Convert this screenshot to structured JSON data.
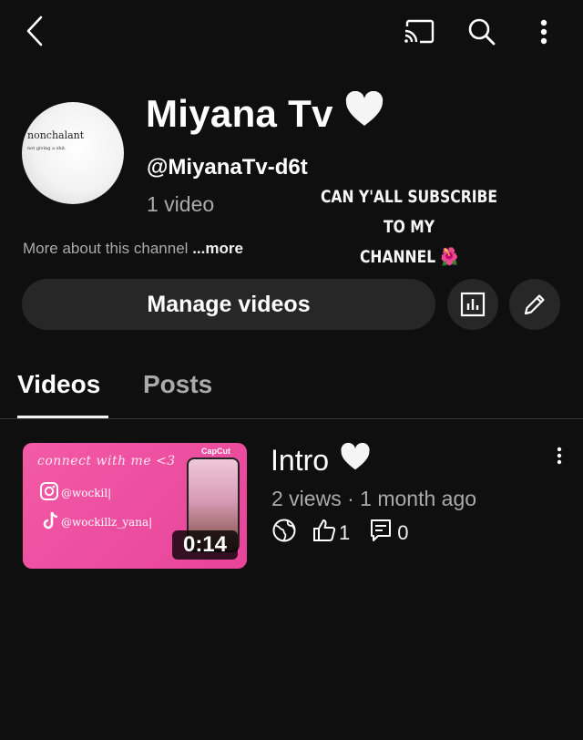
{
  "channel": {
    "name": "Miyana Tv",
    "handle": "@MiyanaTv-d6t",
    "video_count": "1 video",
    "about": "More about this channel",
    "about_more": "...more",
    "avatar_text_main": "nonchalant",
    "avatar_text_sub": "not giving a shit."
  },
  "promo": {
    "line1": "CAN Y'ALL SUBSCRIBE TO MY",
    "line2": "CHANNEL",
    "emoji": "🌺"
  },
  "actions": {
    "manage_label": "Manage videos"
  },
  "tabs": [
    {
      "label": "Videos",
      "active": true
    },
    {
      "label": "Posts",
      "active": false
    }
  ],
  "videos": [
    {
      "title": "Intro",
      "views": "2 views",
      "age": "1 month ago",
      "duration": "0:14",
      "likes": "1",
      "comments": "0",
      "thumbnail": {
        "connect_text": "connect with me <3",
        "instagram": "@wockil|",
        "tiktok": "@wockillz_yana|",
        "brand": "CapCut"
      }
    }
  ],
  "icons": {
    "back": "back-arrow-icon",
    "cast": "cast-icon",
    "search": "search-icon",
    "menu": "more-vert-icon",
    "analytics": "analytics-icon",
    "edit": "edit-pencil-icon",
    "heart": "white-heart-icon",
    "globe": "public-globe-icon",
    "like": "thumbs-up-icon",
    "comment": "comment-icon"
  },
  "colors": {
    "background": "#0f0f0f",
    "button": "#272727",
    "secondary_text": "#aaaaaa",
    "thumb_pink": "#f25aa6"
  }
}
